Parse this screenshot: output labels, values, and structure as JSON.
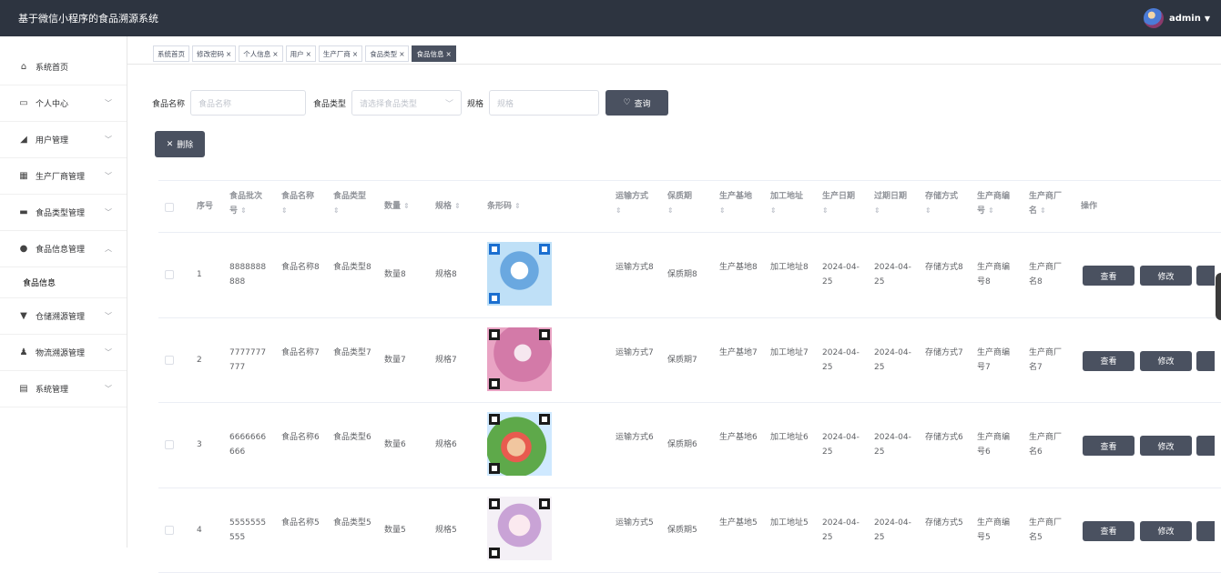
{
  "app": {
    "title": "基于微信小程序的食品溯源系统",
    "user": "admin"
  },
  "sidebar": {
    "items": [
      {
        "label": "系统首页",
        "icon": "home-icon",
        "expanded": false
      },
      {
        "label": "个人中心",
        "icon": "id-card-icon",
        "expanded": false
      },
      {
        "label": "用户管理",
        "icon": "user-manage-icon",
        "expanded": false
      },
      {
        "label": "生产厂商管理",
        "icon": "grid-icon",
        "expanded": false
      },
      {
        "label": "食品类型管理",
        "icon": "comment-icon",
        "expanded": false
      },
      {
        "label": "食品信息管理",
        "icon": "location-icon",
        "expanded": true
      },
      {
        "label": "仓储溯源管理",
        "icon": "shop-icon",
        "expanded": false
      },
      {
        "label": "物流溯源管理",
        "icon": "person-icon",
        "expanded": false
      },
      {
        "label": "系统管理",
        "icon": "clipboard-icon",
        "expanded": false
      }
    ],
    "subitem": "食品信息"
  },
  "tabs": [
    {
      "label": "系统首页",
      "closable": false
    },
    {
      "label": "修改密码",
      "closable": true
    },
    {
      "label": "个人信息",
      "closable": true
    },
    {
      "label": "用户",
      "closable": true
    },
    {
      "label": "生产厂商",
      "closable": true
    },
    {
      "label": "食品类型",
      "closable": true
    },
    {
      "label": "食品信息",
      "closable": true,
      "active": true
    }
  ],
  "search": {
    "name_label": "食品名称",
    "name_placeholder": "食品名称",
    "type_label": "食品类型",
    "type_placeholder": "请选择食品类型",
    "spec_label": "规格",
    "spec_placeholder": "规格",
    "query_button": "查询"
  },
  "delete_button": "删除",
  "table": {
    "headers": {
      "index": "序号",
      "batch": "食品批次号",
      "name": "食品名称",
      "type": "食品类型",
      "qty": "数量",
      "spec": "规格",
      "barcode": "条形码",
      "transport": "运输方式",
      "shelf": "保质期",
      "base": "生产基地",
      "process": "加工地址",
      "mfg": "生产日期",
      "exp": "过期日期",
      "storage": "存储方式",
      "maker_no": "生产商编号",
      "maker_name": "生产商厂名",
      "ops": "操作"
    },
    "rows": [
      {
        "index": "1",
        "batch": "8888888888",
        "name": "食品名称8",
        "type": "食品类型8",
        "qty": "数量8",
        "spec": "规格8",
        "transport": "运输方式8",
        "shelf": "保质期8",
        "base": "生产基地8",
        "process": "加工地址8",
        "mfg": "2024-04-25",
        "exp": "2024-04-25",
        "storage": "存储方式8",
        "maker_no": "生产商编号8",
        "maker_name": "生产商厂名8"
      },
      {
        "index": "2",
        "batch": "7777777777",
        "name": "食品名称7",
        "type": "食品类型7",
        "qty": "数量7",
        "spec": "规格7",
        "transport": "运输方式7",
        "shelf": "保质期7",
        "base": "生产基地7",
        "process": "加工地址7",
        "mfg": "2024-04-25",
        "exp": "2024-04-25",
        "storage": "存储方式7",
        "maker_no": "生产商编号7",
        "maker_name": "生产商厂名7"
      },
      {
        "index": "3",
        "batch": "6666666666",
        "name": "食品名称6",
        "type": "食品类型6",
        "qty": "数量6",
        "spec": "规格6",
        "transport": "运输方式6",
        "shelf": "保质期6",
        "base": "生产基地6",
        "process": "加工地址6",
        "mfg": "2024-04-25",
        "exp": "2024-04-25",
        "storage": "存储方式6",
        "maker_no": "生产商编号6",
        "maker_name": "生产商厂名6"
      },
      {
        "index": "4",
        "batch": "5555555555",
        "name": "食品名称5",
        "type": "食品类型5",
        "qty": "数量5",
        "spec": "规格5",
        "transport": "运输方式5",
        "shelf": "保质期5",
        "base": "生产基地5",
        "process": "加工地址5",
        "mfg": "2024-04-25",
        "exp": "2024-04-25",
        "storage": "存储方式5",
        "maker_no": "生产商编号5",
        "maker_name": "生产商厂名5"
      }
    ],
    "actions": {
      "view": "查看",
      "edit": "修改"
    }
  }
}
